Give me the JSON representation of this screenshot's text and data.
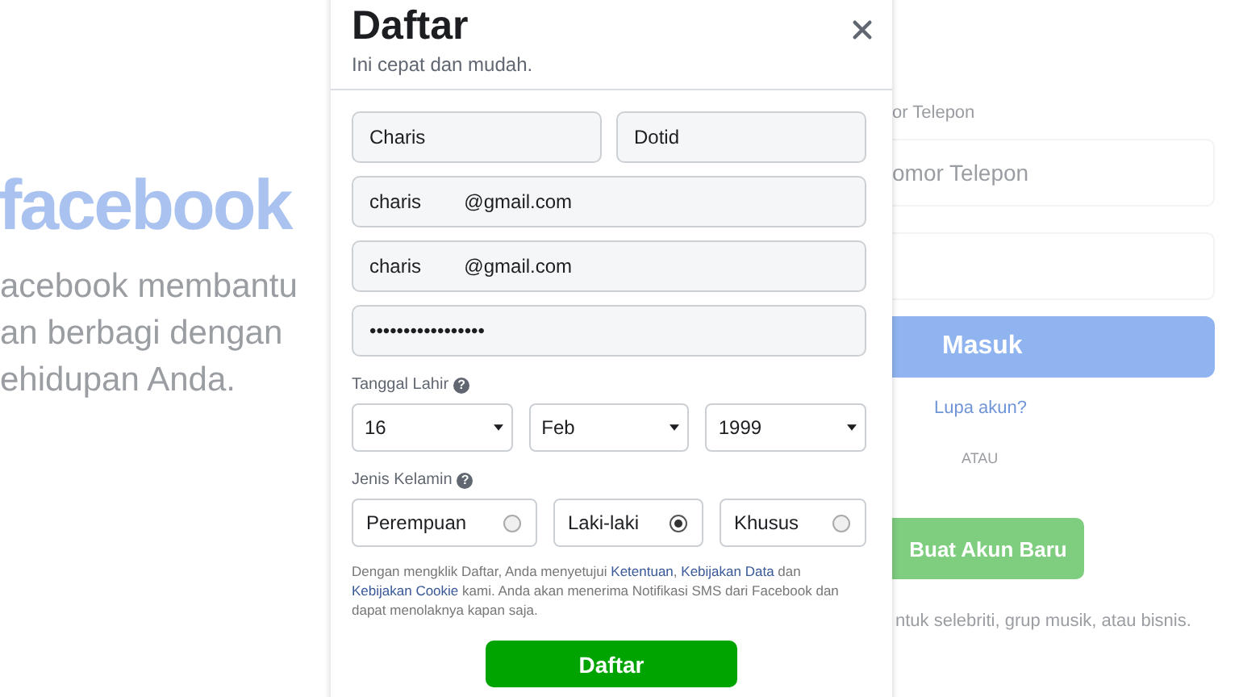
{
  "background": {
    "logo": "facebook",
    "tagline_lines": [
      "acebook membantu",
      "an berbagi dengan",
      "ehidupan Anda."
    ],
    "phone_label": "or Telepon",
    "phone_placeholder": "omor Telepon",
    "login_button": "Masuk",
    "forgot_link": "Lupa akun?",
    "divider_text": "ATAU",
    "create_button": "Buat Akun Baru",
    "page_text": "ntuk selebriti, grup musik, atau bisnis."
  },
  "modal": {
    "title": "Daftar",
    "subtitle": "Ini cepat dan mudah.",
    "name_fields": [
      {
        "value": "Charis"
      },
      {
        "value": "Dotid"
      }
    ],
    "fields": [
      {
        "value": "charis        @gmail.com"
      },
      {
        "value": "charis        @gmail.com"
      },
      {
        "value": "•••••••••••••••••"
      }
    ],
    "birthday": {
      "label": "Tanggal Lahir",
      "help": "?",
      "selects": [
        {
          "value": "16"
        },
        {
          "value": "Feb"
        },
        {
          "value": "1999"
        }
      ]
    },
    "gender": {
      "label": "Jenis Kelamin",
      "help": "?",
      "options": [
        {
          "label": "Perempuan",
          "selected": false
        },
        {
          "label": "Laki-laki",
          "selected": true
        },
        {
          "label": "Khusus",
          "selected": false
        }
      ]
    },
    "terms": [
      {
        "kind": "text",
        "text": "Dengan mengklik Daftar, Anda menyetujui "
      },
      {
        "kind": "link",
        "text": "Ketentuan"
      },
      {
        "kind": "text",
        "text": ", "
      },
      {
        "kind": "link",
        "text": "Kebijakan Data"
      },
      {
        "kind": "text",
        "text": " dan "
      },
      {
        "kind": "link",
        "text": "Kebijakan Cookie"
      },
      {
        "kind": "text",
        "text": " kami. Anda akan menerima Notifikasi SMS dari Facebook dan dapat menolaknya kapan saja."
      }
    ],
    "submit": "Daftar"
  }
}
